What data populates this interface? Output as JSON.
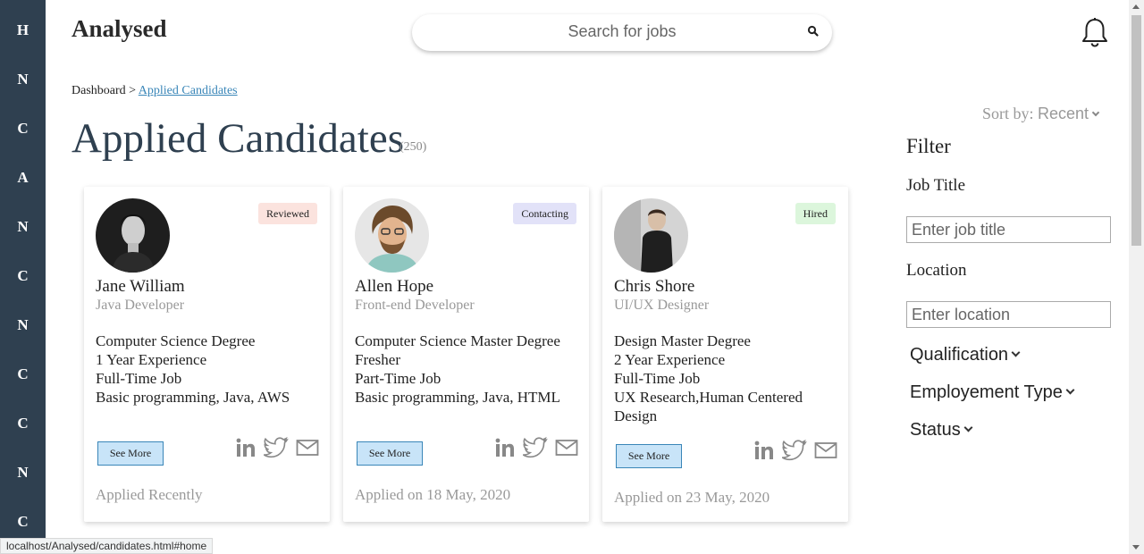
{
  "sidebar": {
    "letters": [
      "H",
      "N",
      "C",
      "A",
      "N",
      "C",
      "N",
      "C",
      "C",
      "N",
      "C"
    ]
  },
  "header": {
    "brand": "Analysed",
    "search_placeholder": "Search for jobs",
    "search_icon": "search-icon",
    "bell_icon": "bell-icon"
  },
  "breadcrumb": {
    "root": "Dashboard",
    "separator": ">",
    "current": "Applied Candidates"
  },
  "page": {
    "title": "Applied Candidates",
    "count": "(250)"
  },
  "sort": {
    "label": "Sort by:",
    "value": "Recent"
  },
  "candidates": [
    {
      "name": "Jane William",
      "role": "Java Developer",
      "status": "Reviewed",
      "status_color": "#fbe3de",
      "details": [
        "Computer Science Degree",
        "1 Year Experience",
        "Full-Time Job",
        "Basic programming, Java, AWS"
      ],
      "button": "See More",
      "applied": "Applied Recently"
    },
    {
      "name": "Allen Hope",
      "role": "Front-end Developer",
      "status": "Contacting",
      "status_color": "#e2e2f8",
      "details": [
        "Computer Science Master Degree",
        "Fresher",
        "Part-Time Job",
        "Basic programming, Java, HTML"
      ],
      "button": "See More",
      "applied": "Applied on 18 May, 2020"
    },
    {
      "name": "Chris Shore",
      "role": "UI/UX Designer",
      "status": "Hired",
      "status_color": "#dcf6dc",
      "details": [
        "Design Master Degree",
        "2 Year Experience",
        "Full-Time Job",
        "UX Research,Human Centered Design"
      ],
      "button": "See More",
      "applied": "Applied on 23 May, 2020"
    }
  ],
  "filter": {
    "title": "Filter",
    "job_title_label": "Job Title",
    "job_title_placeholder": "Enter job title",
    "location_label": "Location",
    "location_placeholder": "Enter location",
    "dropdowns": [
      "Qualification",
      "Employement Type",
      "Status"
    ]
  },
  "statusbar": {
    "url": "localhost/Analysed/candidates.html#home"
  },
  "colors": {
    "sidebar": "#2f4050",
    "accent_link": "#3a86b8",
    "button_bg": "#c8e4f8"
  }
}
